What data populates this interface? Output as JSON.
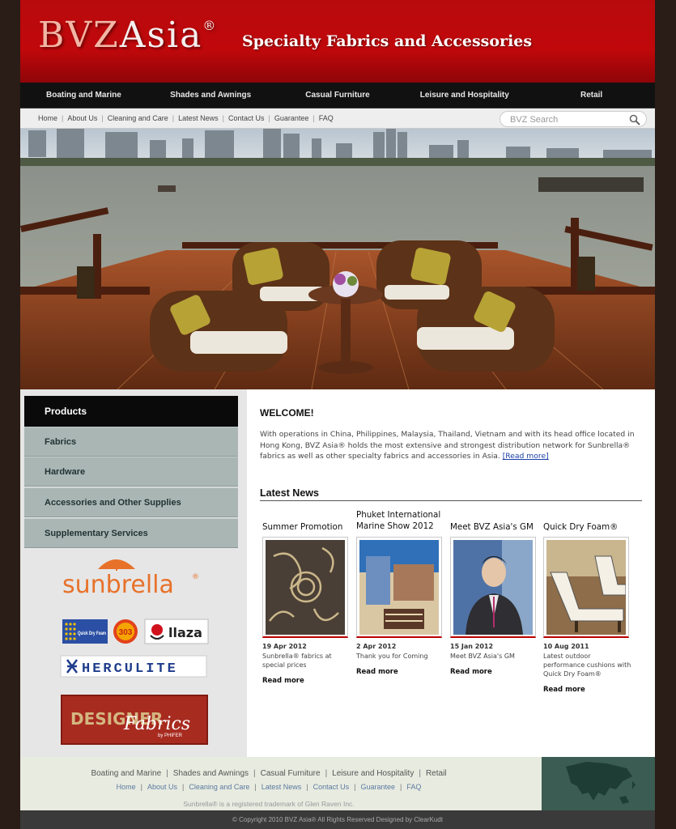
{
  "header": {
    "logo_main": "BVZ",
    "logo_rest": "Asia",
    "logo_reg": "®",
    "tagline": "Specialty Fabrics and Accessories"
  },
  "main_nav": [
    {
      "label": "Boating and Marine"
    },
    {
      "label": "Shades and Awnings"
    },
    {
      "label": "Casual Furniture"
    },
    {
      "label": "Leisure and Hospitality"
    },
    {
      "label": "Retail"
    }
  ],
  "sub_nav": [
    {
      "label": "Home"
    },
    {
      "label": "About Us"
    },
    {
      "label": "Cleaning and Care"
    },
    {
      "label": "Latest News"
    },
    {
      "label": "Contact Us"
    },
    {
      "label": "Guarantee"
    },
    {
      "label": "FAQ"
    }
  ],
  "search": {
    "placeholder": "BVZ Search"
  },
  "sidebar": {
    "header": "Products",
    "items": [
      {
        "label": "Fabrics"
      },
      {
        "label": "Hardware"
      },
      {
        "label": "Accessories and Other Supplies"
      },
      {
        "label": "Supplementary Services"
      }
    ],
    "brands": {
      "sunbrella": "sunbrella",
      "quick_dry": "Quick Dry Foam",
      "badge_303": "303",
      "llaza": "llaza",
      "herculite": "HERCULITE",
      "designer": "DESIGNER",
      "fabrics": "Fabrics",
      "phifer": "by PHIFER"
    }
  },
  "welcome": {
    "title": "WELCOME!",
    "text": "With operations in China, Philippines, Malaysia, Thailand, Vietnam and with its head office located in Hong Kong, BVZ Asia® holds the most extensive and strongest distribution network for Sunbrella® fabrics as well as other specialty fabrics and accessories in Asia. ",
    "read_more": "[Read more]"
  },
  "news": {
    "title": "Latest News",
    "items": [
      {
        "title": "Summer Promotion",
        "date": "19 Apr 2012",
        "desc": "Sunbrella® fabrics at special prices",
        "more": "Read more"
      },
      {
        "title": "Phuket International Marine Show 2012",
        "date": "2 Apr 2012",
        "desc": "Thank you for Coming",
        "more": "Read more"
      },
      {
        "title": "Meet BVZ Asia's GM",
        "date": "15 Jan 2012",
        "desc": "Meet BVZ Asia's GM",
        "more": "Read more"
      },
      {
        "title": "Quick Dry Foam®",
        "date": "10 Aug 2011",
        "desc": "Latest outdoor performance cushions with Quick Dry Foam®",
        "more": "Read more"
      }
    ]
  },
  "footer": {
    "nav1": [
      {
        "label": "Boating and Marine"
      },
      {
        "label": "Shades and Awnings"
      },
      {
        "label": "Casual Furniture"
      },
      {
        "label": "Leisure and Hospitality"
      },
      {
        "label": "Retail"
      }
    ],
    "nav2": [
      {
        "label": "Home"
      },
      {
        "label": "About Us"
      },
      {
        "label": "Cleaning and Care"
      },
      {
        "label": "Latest News"
      },
      {
        "label": "Contact Us"
      },
      {
        "label": "Guarantee"
      },
      {
        "label": "FAQ"
      }
    ],
    "trademark": "Sunbrella® is a registered trademark of Glen Raven Inc.",
    "copyright": "© Copyright 2010 BVZ Asia® All Rights Reserved Designed by ClearKudt"
  },
  "colors": {
    "header_red": "#b80a0d",
    "nav_black": "#111111",
    "sidebar_item": "#a9b6b4",
    "link_blue": "#1a3fa8",
    "page_bg": "#2a1c16"
  }
}
